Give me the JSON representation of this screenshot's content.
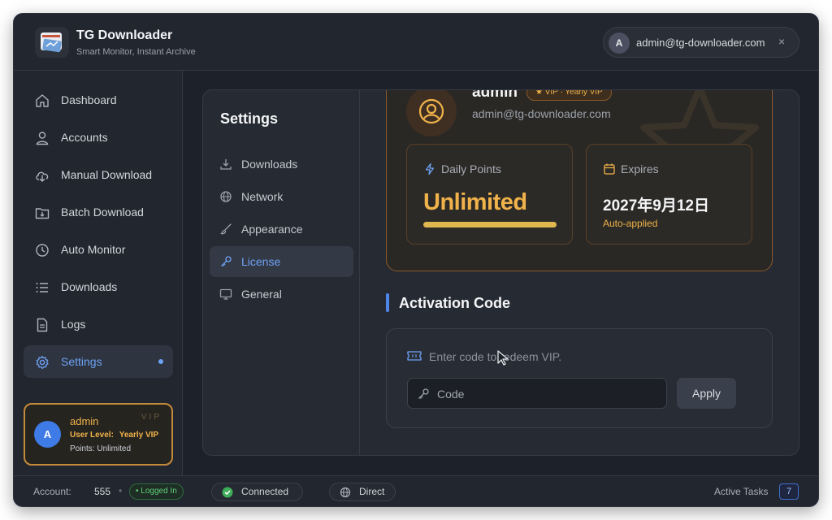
{
  "app": {
    "title": "TG Downloader",
    "subtitle": "Smart Monitor, Instant Archive",
    "logo_icon": "app-logo-icon"
  },
  "header": {
    "user_initial": "A",
    "user_email": "admin@tg-downloader.com",
    "close_glyph": "×"
  },
  "sidebar": {
    "items": [
      {
        "label": "Dashboard",
        "icon": "home-icon"
      },
      {
        "label": "Accounts",
        "icon": "user-icon"
      },
      {
        "label": "Manual Download",
        "icon": "cloud-download-icon"
      },
      {
        "label": "Batch Download",
        "icon": "folder-download-icon"
      },
      {
        "label": "Auto Monitor",
        "icon": "clock-icon"
      },
      {
        "label": "Downloads",
        "icon": "list-icon"
      },
      {
        "label": "Logs",
        "icon": "document-icon"
      },
      {
        "label": "Settings",
        "icon": "gear-icon",
        "active": true
      }
    ],
    "vip_card": {
      "initial": "A",
      "username": "admin",
      "watermark": "VIP",
      "level_label": "User Level:",
      "level_value": "Yearly VIP",
      "points": "Points: Unlimited"
    }
  },
  "settings": {
    "title": "Settings",
    "nav": [
      {
        "label": "Downloads",
        "icon": "download-icon"
      },
      {
        "label": "Network",
        "icon": "globe-icon"
      },
      {
        "label": "Appearance",
        "icon": "brush-icon"
      },
      {
        "label": "License",
        "icon": "key-icon",
        "active": true
      },
      {
        "label": "General",
        "icon": "monitor-icon"
      }
    ]
  },
  "license": {
    "name": "admin",
    "badge": "★ VIP · Yearly VIP",
    "email": "admin@tg-downloader.com",
    "daily_points": {
      "label": "Daily Points",
      "value": "Unlimited",
      "fill_percent": 100
    },
    "expires": {
      "label": "Expires",
      "value": "2027年9月12日",
      "note": "Auto-applied"
    }
  },
  "activation": {
    "title": "Activation Code",
    "hint": "Enter code to redeem VIP.",
    "input_placeholder": "Code",
    "apply_label": "Apply"
  },
  "statusbar": {
    "account_label": "Account:",
    "account_count": "555",
    "separator": "•",
    "logged_in": "• Logged In",
    "connection": "Connected",
    "proxy": "Direct",
    "active_tasks_label": "Active Tasks",
    "active_tasks_count": "7"
  },
  "colors": {
    "accent_blue": "#6ea2f5",
    "vip_gold": "#f0b24a",
    "background": "#1d2129",
    "success_green": "#5fcf7a"
  }
}
